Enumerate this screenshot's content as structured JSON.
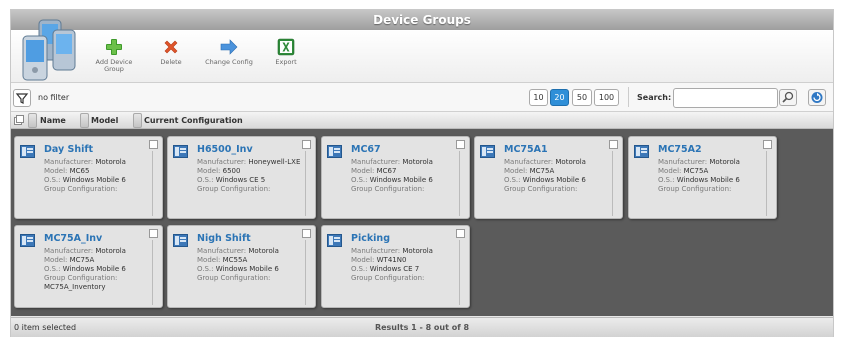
{
  "window": {
    "title": "Device Groups"
  },
  "toolbar": {
    "add_label": "Add Device Group",
    "delete_label": "Delete",
    "change_label": "Change Config",
    "export_label": "Export"
  },
  "filter": {
    "text": "no filter"
  },
  "pagination": {
    "sizes": [
      "10",
      "20",
      "50",
      "100"
    ],
    "active": "20"
  },
  "search": {
    "label": "Search:",
    "value": ""
  },
  "columns": {
    "name": "Name",
    "model": "Model",
    "config": "Current Configuration"
  },
  "labels": {
    "manufacturer": "Manufacturer:",
    "model": "Model:",
    "os": "O.S.:",
    "group_config": "Group Configuration:"
  },
  "groups": [
    {
      "name": "Day Shift",
      "manufacturer": "Motorola",
      "model": "MC65",
      "os": "Windows Mobile 6",
      "config": ""
    },
    {
      "name": "H6500_Inv",
      "manufacturer": "Honeywell-LXE",
      "model": "6500",
      "os": "Windows CE 5",
      "config": ""
    },
    {
      "name": "MC67",
      "manufacturer": "Motorola",
      "model": "MC67",
      "os": "Windows Mobile 6",
      "config": ""
    },
    {
      "name": "MC75A1",
      "manufacturer": "Motorola",
      "model": "MC75A",
      "os": "Windows Mobile 6",
      "config": ""
    },
    {
      "name": "MC75A2",
      "manufacturer": "Motorola",
      "model": "MC75A",
      "os": "Windows Mobile 6",
      "config": ""
    },
    {
      "name": "MC75A_Inv",
      "manufacturer": "Motorola",
      "model": "MC75A",
      "os": "Windows Mobile 6",
      "config": "MC75A_Inventory"
    },
    {
      "name": "Nigh Shift",
      "manufacturer": "Motorola",
      "model": "MC55A",
      "os": "Windows Mobile 6",
      "config": ""
    },
    {
      "name": "Picking",
      "manufacturer": "Motorola",
      "model": "WT41N0",
      "os": "Windows CE 7",
      "config": ""
    }
  ],
  "status": {
    "selected": "0 item selected",
    "results": "Results 1 - 8 out of 8"
  },
  "colors": {
    "accent": "#2f8fd8",
    "name_link": "#2b74b5",
    "grid_bg": "#5b5b5b"
  }
}
